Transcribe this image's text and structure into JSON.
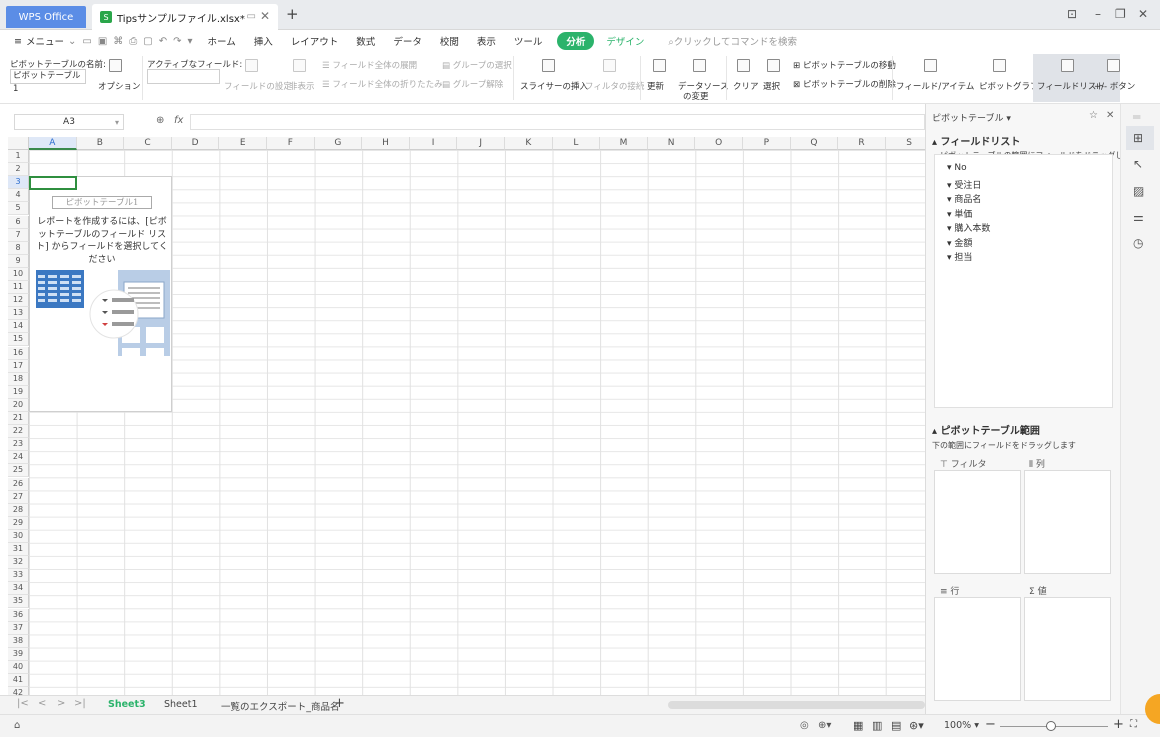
{
  "titlebar": {
    "app_tab": "WPS Office",
    "file_tab": "Tipsサンプルファイル.xlsx*",
    "new_tab": "+"
  },
  "menubar": {
    "menu": "メニュー",
    "tabs": [
      "ホーム",
      "挿入",
      "レイアウト",
      "数式",
      "データ",
      "校閲",
      "表示",
      "ツール"
    ],
    "active_tab": "分析",
    "design_tab": "デザイン",
    "search": "クリックしてコマンドを検索"
  },
  "ribbon": {
    "pivot_name_label": "ピボットテーブルの名前:",
    "pivot_name_value": "ピボットテーブル1",
    "options": "オプション",
    "active_field_label": "アクティブなフィールド:",
    "field_settings": "フィールドの設定",
    "hide": "非表示",
    "expand_all": "フィールド全体の展開",
    "collapse_all": "フィールド全体の折りたたみ",
    "group_select": "グループの選択",
    "ungroup": "グループ解除",
    "insert_slicer": "スライサーの挿入",
    "filter_connect": "フィルタの接続",
    "refresh": "更新",
    "data_source_1": "データソース",
    "data_source_2": "の変更",
    "clear": "クリア",
    "select": "選択",
    "move_pivot": "ピボットテーブルの移動",
    "delete_pivot": "ピボットテーブルの削除",
    "field_item": "フィールド/アイテム",
    "pivot_graph": "ピボットグラフ",
    "field_list": "フィールドリスト",
    "plus_minus": "+/- ボタン"
  },
  "formula": {
    "namebox": "A3",
    "fx": "fx"
  },
  "grid": {
    "columns": [
      "A",
      "B",
      "C",
      "D",
      "E",
      "F",
      "G",
      "H",
      "I",
      "J",
      "K",
      "L",
      "M",
      "N",
      "O",
      "P",
      "Q",
      "R",
      "S"
    ],
    "rows": [
      "1",
      "2",
      "3",
      "4",
      "5",
      "6",
      "7",
      "8",
      "9",
      "10",
      "11",
      "12",
      "13",
      "14",
      "15",
      "16",
      "17",
      "18",
      "19",
      "20",
      "21",
      "22",
      "23",
      "24",
      "25",
      "26",
      "27",
      "28",
      "29",
      "30",
      "31",
      "32",
      "33",
      "34",
      "35",
      "36",
      "37",
      "38",
      "39",
      "40",
      "41",
      "42"
    ],
    "pivot_title": "ピボットテーブル1",
    "pivot_text": "レポートを作成するには、[ピボットテーブルのフィールド リスト] からフィールドを選択してください"
  },
  "sheets": {
    "tabs": [
      "Sheet3",
      "Sheet1",
      "一覧のエクスポート_商品名"
    ],
    "add": "+"
  },
  "status": {
    "zoom": "100%"
  },
  "pane": {
    "title": "ピボットテーブル",
    "field_list_header": "フィールドリスト",
    "field_list_hint": "ピボットテーブルの範囲にフィールドをドラッグします",
    "fields": [
      "No",
      "受注日",
      "商品名",
      "単価",
      "購入本数",
      "金額",
      "担当"
    ],
    "range_header": "ピボットテーブル範囲",
    "range_hint": "下の範囲にフィールドをドラッグします",
    "filter": "フィルタ",
    "column": "列",
    "row": "行",
    "value": "値"
  }
}
